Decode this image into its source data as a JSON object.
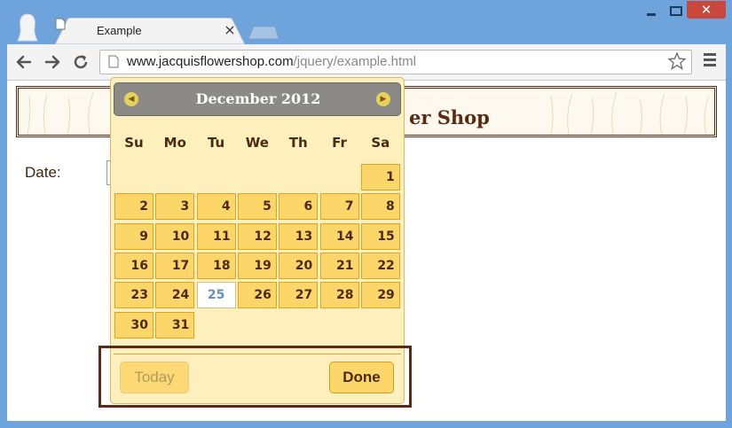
{
  "tab": {
    "title": "Example"
  },
  "address_bar": {
    "domain": "www.jacquisflowershop.com",
    "path": "/jquery/example.html"
  },
  "page": {
    "banner_title_visible": "er Shop",
    "date_label": "Date:"
  },
  "datepicker": {
    "month_year": "December 2012",
    "weekdays": [
      "Su",
      "Mo",
      "Tu",
      "We",
      "Th",
      "Fr",
      "Sa"
    ],
    "first_weekday_index": 6,
    "days_in_month": 31,
    "highlighted_day": 25,
    "today_button": "Today",
    "done_button": "Done"
  },
  "colors": {
    "window_frame": "#6fa3dc",
    "datepicker_bg": "#fdf0bc",
    "day_cell": "#fcd669",
    "header": "#8c8a87",
    "accent_brown": "#5a2a12"
  }
}
